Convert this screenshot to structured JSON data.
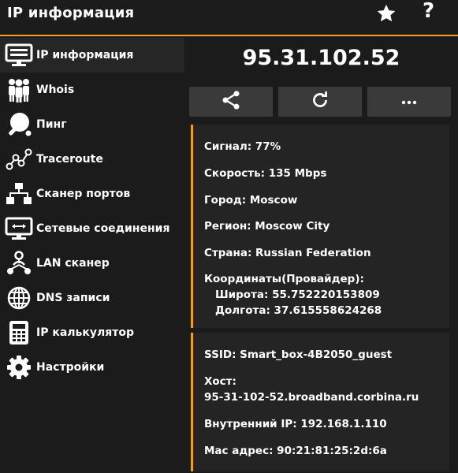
{
  "header": {
    "title": "IP информация",
    "favorite_icon": "star-icon",
    "help_label": "?"
  },
  "sidebar": {
    "items": [
      {
        "label": "IP информация",
        "icon": "monitor-icon",
        "active": true
      },
      {
        "label": "Whois",
        "icon": "people-icon"
      },
      {
        "label": "Пинг",
        "icon": "ping-pong-icon"
      },
      {
        "label": "Traceroute",
        "icon": "route-icon"
      },
      {
        "label": "Сканер портов",
        "icon": "network-tree-icon"
      },
      {
        "label": "Сетевые соединения",
        "icon": "network-connections-icon"
      },
      {
        "label": "LAN сканер",
        "icon": "lan-icon"
      },
      {
        "label": "DNS записи",
        "icon": "globe-icon"
      },
      {
        "label": "IP калькулятор",
        "icon": "calculator-icon"
      },
      {
        "label": "Настройки",
        "icon": "gear-icon"
      }
    ]
  },
  "main": {
    "ip": "95.31.102.52",
    "actions": [
      {
        "name": "share",
        "icon": "share-icon"
      },
      {
        "name": "refresh",
        "icon": "refresh-icon"
      },
      {
        "name": "more",
        "icon": "more-icon"
      }
    ],
    "location_card": {
      "signal": "Сигнал: 77%",
      "speed": "Скорость: 135 Mbps",
      "city": "Город: Moscow",
      "region": "Регион: Moscow City",
      "country": "Страна: Russian Federation",
      "coords_title": "Координаты(Провайдер):",
      "latitude": "Широта: 55.752220153809",
      "longitude": "Долгота: 37.615558624268"
    },
    "network_card": {
      "ssid": "SSID: Smart_box-4B2050_guest",
      "host_label": "Хост:",
      "host_value": "95-31-102-52.broadband.corbina.ru",
      "internal_ip": "Внутренний IP: 192.168.1.110",
      "mac": "Mac адрес: 90:21:81:25:2d:6a"
    }
  },
  "colors": {
    "accent": "#f0a020",
    "background": "#1b1b1b",
    "card": "#242424",
    "button": "#3a3a3a"
  }
}
